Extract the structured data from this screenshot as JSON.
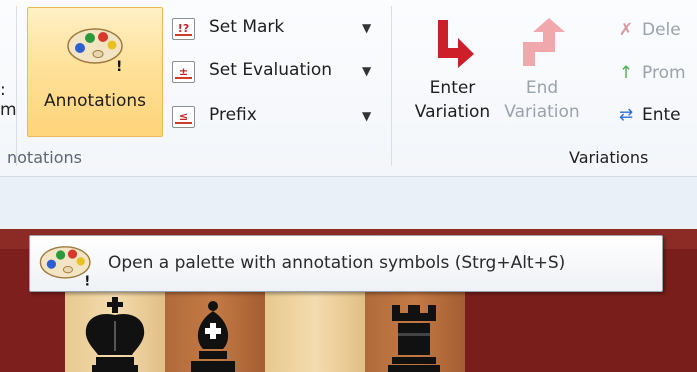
{
  "ribbon": {
    "cut_label_top": ":",
    "cut_label_bottom": "m",
    "annotations_group": {
      "caption": "notations",
      "big_button": {
        "label": "Annotations",
        "icon": "palette-icon"
      },
      "small_buttons": [
        {
          "label": "Set Mark",
          "icon": "set-mark-icon"
        },
        {
          "label": "Set Evaluation",
          "icon": "set-evaluation-icon"
        },
        {
          "label": "Prefix",
          "icon": "prefix-icon"
        }
      ]
    },
    "variations_group": {
      "caption": "Variations",
      "enter_variation": {
        "line1": "Enter",
        "line2": "Variation",
        "icon": "enter-variation-arrow-icon"
      },
      "end_variation": {
        "line1": "End",
        "line2": "Variation",
        "icon": "end-variation-arrow-icon"
      },
      "right_items": [
        {
          "label": "Dele",
          "icon": "delete-icon",
          "disabled": true
        },
        {
          "label": "Prom",
          "icon": "promote-icon",
          "disabled": true
        },
        {
          "label": "Ente",
          "icon": "enter-icon",
          "disabled": false
        }
      ]
    }
  },
  "tooltip": {
    "text": "Open a palette with annotation symbols (Strg+Alt+S)",
    "icon": "palette-icon"
  },
  "board": {
    "pieces": [
      "black-king-icon",
      "black-bishop-icon",
      "black-rook-icon"
    ]
  },
  "colors": {
    "highlight": "#ffd47a",
    "enter_arrow": "#cc1f2a",
    "end_arrow": "#f0a8ac",
    "board_frame": "#7d1f1c"
  }
}
